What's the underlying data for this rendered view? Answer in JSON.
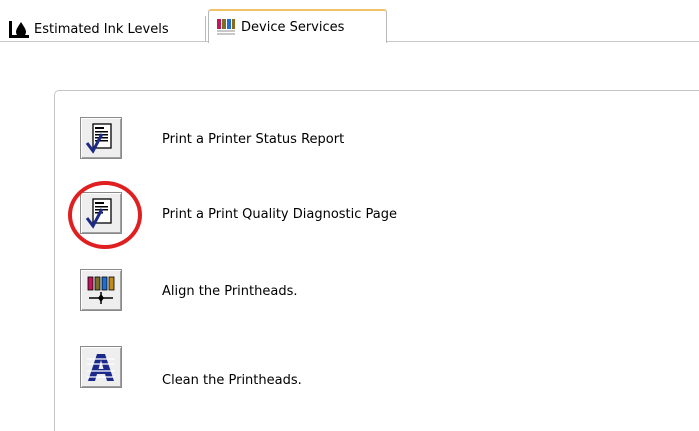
{
  "tabs": [
    {
      "label": "Estimated Ink Levels",
      "icon": "ink-drop-icon",
      "selected": false
    },
    {
      "label": "Device Services",
      "icon": "ink-cartridges-icon",
      "selected": true
    }
  ],
  "actions": [
    {
      "label": "Print a Printer Status Report",
      "icon": "status-report-icon"
    },
    {
      "label": "Print a Print Quality Diagnostic Page",
      "icon": "diagnostic-page-icon",
      "highlighted": true
    },
    {
      "label": "Align the Printheads.",
      "icon": "align-printheads-icon"
    },
    {
      "label": "Clean the Printheads.",
      "icon": "clean-printheads-icon"
    }
  ],
  "colors": {
    "highlight_ring": "#e02020",
    "checkmark": "#1b2a8a",
    "active_tab_accent": "#f0c36a"
  }
}
